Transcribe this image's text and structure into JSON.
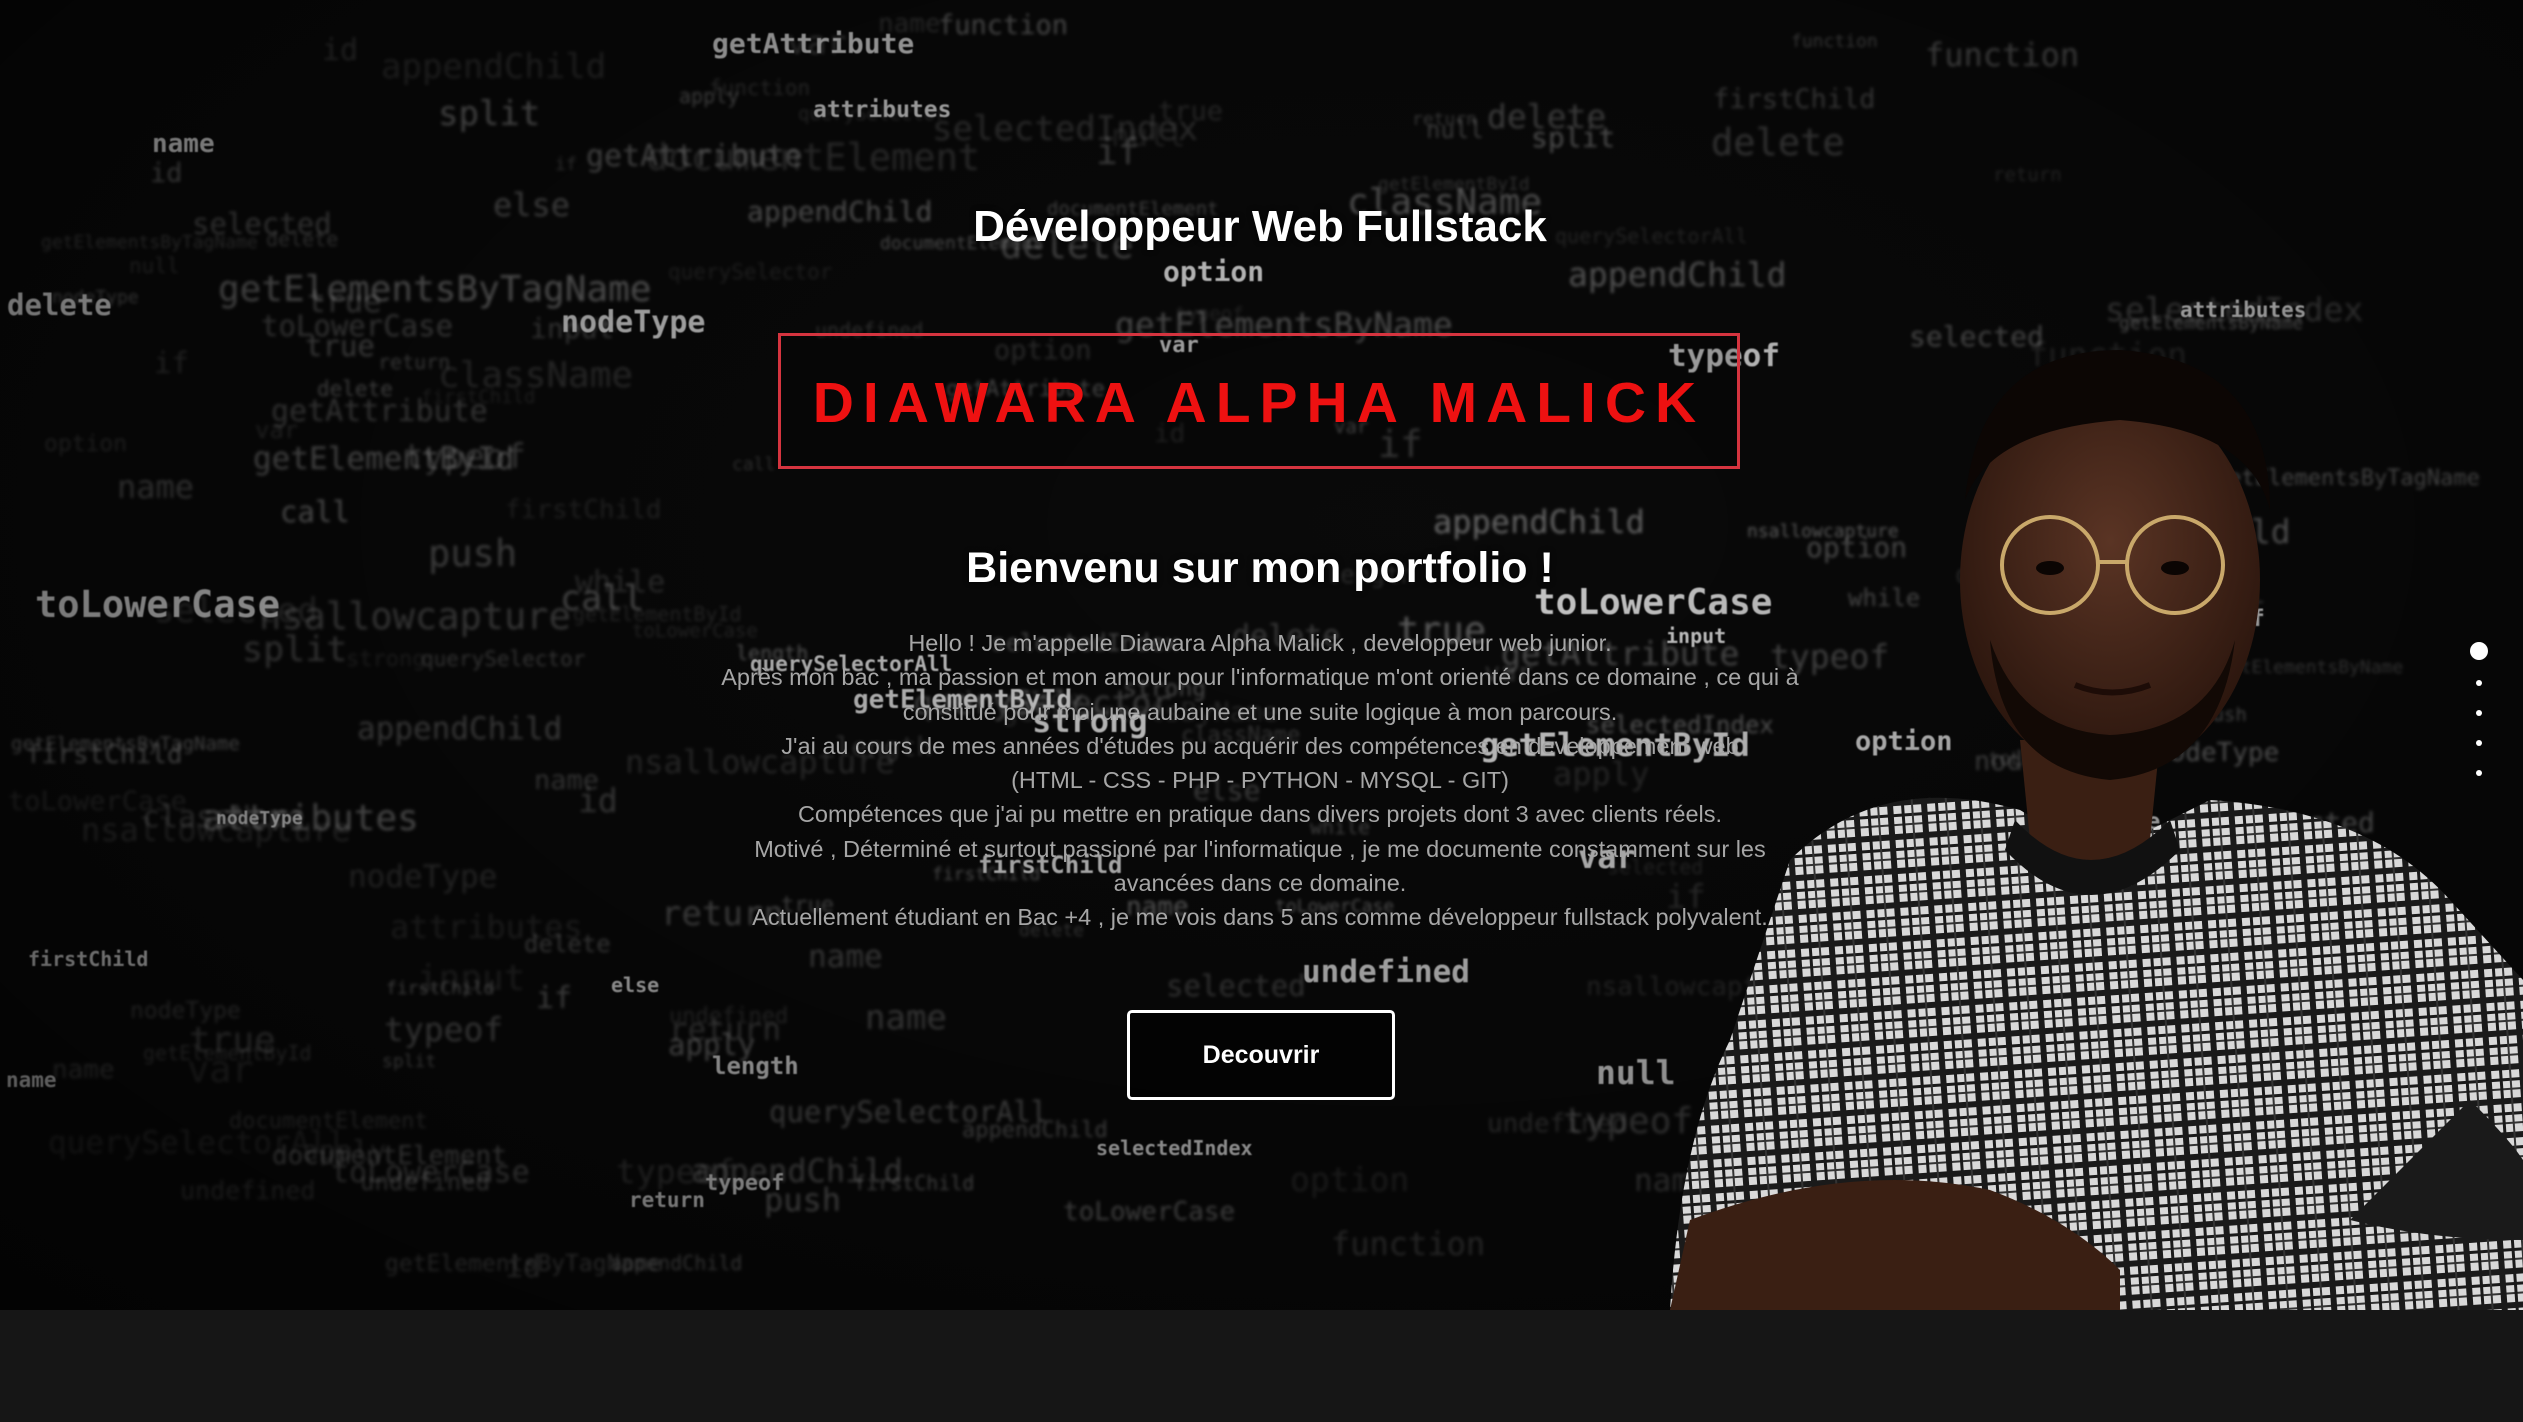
{
  "hero": {
    "subtitle": "Développeur Web Fullstack",
    "name": "DIAWARA ALPHA MALICK",
    "welcome": "Bienvenu sur mon portfolio !",
    "bio_lines": [
      "Hello ! Je m'appelle Diawara Alpha Malick , developpeur web junior.",
      "Après mon bac , ma passion et mon amour pour l'informatique m'ont orienté dans ce domaine , ce qui à",
      "constitué pour moi une aubaine et une suite logique à mon parcours.",
      "J'ai au cours de mes années d'études pu acquérir des compétences en developpement web",
      "(HTML - CSS - PHP - PYTHON - MYSQL - GIT)",
      "Compétences que j'ai pu mettre en pratique dans divers projets dont 3 avec clients réels.",
      "Motivé , Déterminé et surtout passioné par l'informatique , je me documente constamment sur les",
      "avancées dans ce domaine.",
      "Actuellement étudiant en Bac +4 , je me vois dans 5 ans comme développeur fullstack polyvalent."
    ],
    "button_label": "Decouvrir"
  },
  "background_code": [
    "length",
    "getElementsByName",
    "strong",
    "firstChild",
    "function",
    "var",
    "return",
    "getAttribute",
    "appendChild",
    "id",
    "delete",
    "className",
    "querySelectorAll",
    "undefined",
    "typeof",
    "while",
    "push",
    "split",
    "toLowerCase",
    "documentElement",
    "call",
    "null",
    "getElementById",
    "attributes",
    "getElementsByTagName",
    "input",
    "if",
    "else",
    "true",
    "nsallowcapture",
    "apply",
    "option",
    "name",
    "selected",
    "querySelector",
    "selectedIndex",
    "nodeType"
  ],
  "nav_dots": {
    "count": 5,
    "active_index": 0
  },
  "colors": {
    "name_text": "#ee1111",
    "name_border": "#d5343f",
    "bio_text": "#a6a6a6",
    "background": "#0a0a0a",
    "footer": "#161616"
  }
}
